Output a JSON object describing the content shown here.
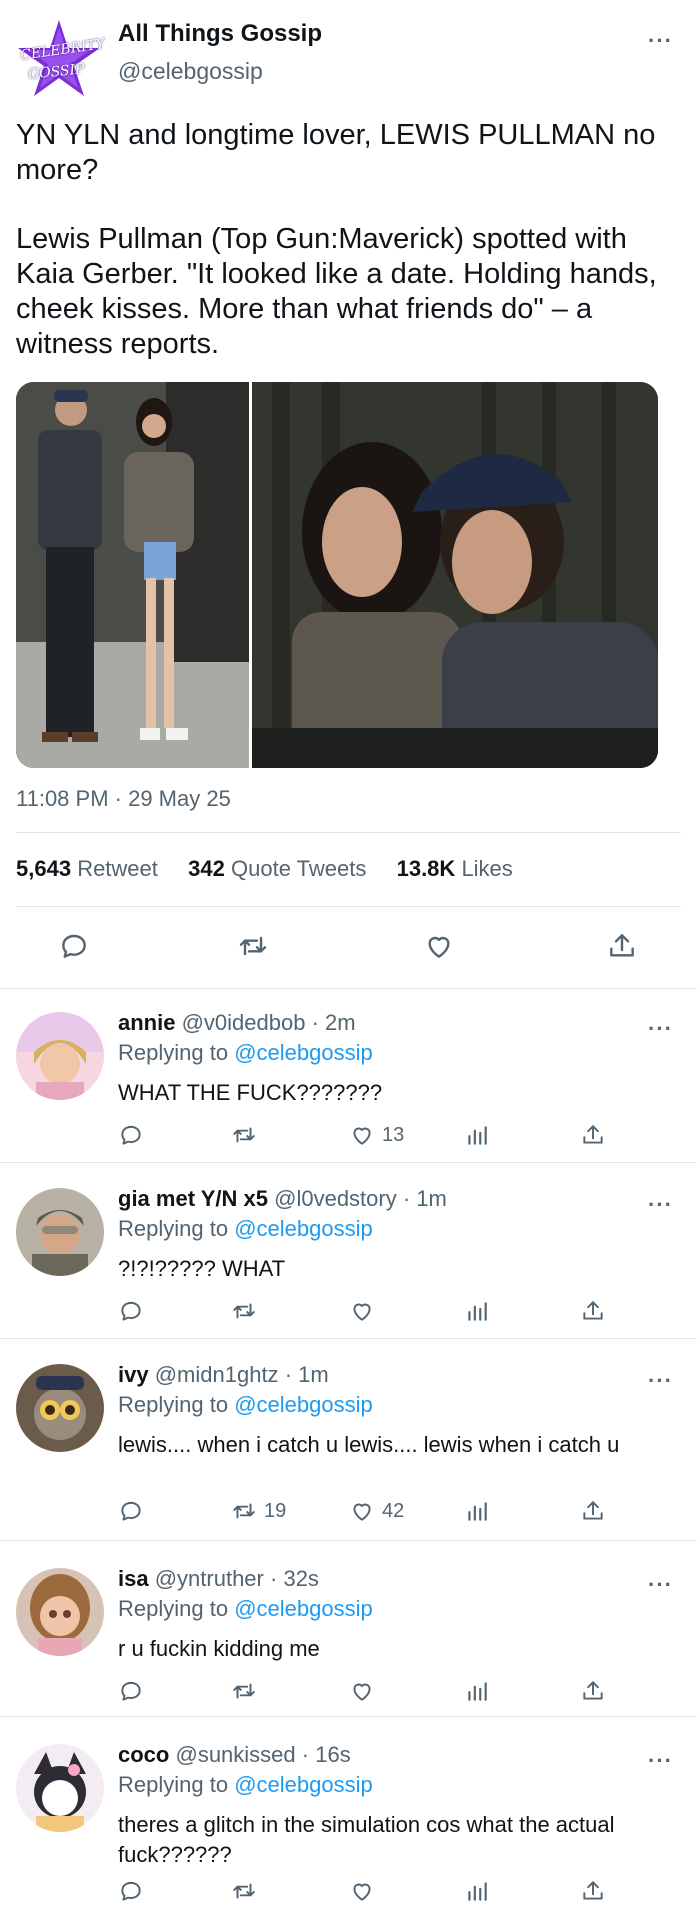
{
  "tweet": {
    "display_name": "All Things Gossip",
    "handle": "@celebgossip",
    "avatar_text_1": "CELEBRITY",
    "avatar_text_2": "GOSSIP",
    "text_p1": "YN YLN and longtime lover, LEWIS PULLMAN no more?",
    "text_p2": "Lewis Pullman (Top Gun:Maverick) spotted with Kaia Gerber. \"It looked like a date. Holding hands, cheek kisses. More than what friends do\" – a witness reports.",
    "timestamp": "11:08 PM · 29 May 25",
    "stats": {
      "retweets_count": "5,643",
      "retweets_label": "Retweet",
      "quotes_count": "342",
      "quotes_label": "Quote Tweets",
      "likes_count": "13.8K",
      "likes_label": "Likes"
    }
  },
  "replies": [
    {
      "name": "annie",
      "handle": "@v0idedbob",
      "time": "2m",
      "replying_prefix": "Replying to",
      "replying_to": "@celebgossip",
      "text": "WHAT THE FUCK???????",
      "retweets": "",
      "likes": "13"
    },
    {
      "name": "gia met Y/N x5",
      "handle": "@l0vedstory",
      "time": "1m",
      "replying_prefix": "Replying to",
      "replying_to": "@celebgossip",
      "text": "?!?!????? WHAT",
      "retweets": "",
      "likes": ""
    },
    {
      "name": "ivy",
      "handle": "@midn1ghtz",
      "time": "1m",
      "replying_prefix": "Replying to",
      "replying_to": "@celebgossip",
      "text": "lewis.... when i catch u lewis.... lewis when i catch u",
      "retweets": "19",
      "likes": "42"
    },
    {
      "name": "isa",
      "handle": "@yntruther",
      "time": "32s",
      "replying_prefix": "Replying to",
      "replying_to": "@celebgossip",
      "text": "r u fuckin kidding me",
      "retweets": "",
      "likes": ""
    },
    {
      "name": "coco",
      "handle": "@sunkissed",
      "time": "16s",
      "replying_prefix": "Replying to",
      "replying_to": "@celebgossip",
      "text": "theres a glitch in the simulation cos what the actual fuck??????",
      "retweets": "",
      "likes": ""
    }
  ],
  "colors": {
    "accent": "#1d9bf0",
    "text": "#0f1419",
    "muted": "#536471",
    "divider": "#e3e6e8",
    "brand_purple": "#7b2fd6"
  },
  "icons": [
    "more-icon",
    "reply-icon",
    "retweet-icon",
    "like-icon",
    "share-icon",
    "views-icon"
  ]
}
